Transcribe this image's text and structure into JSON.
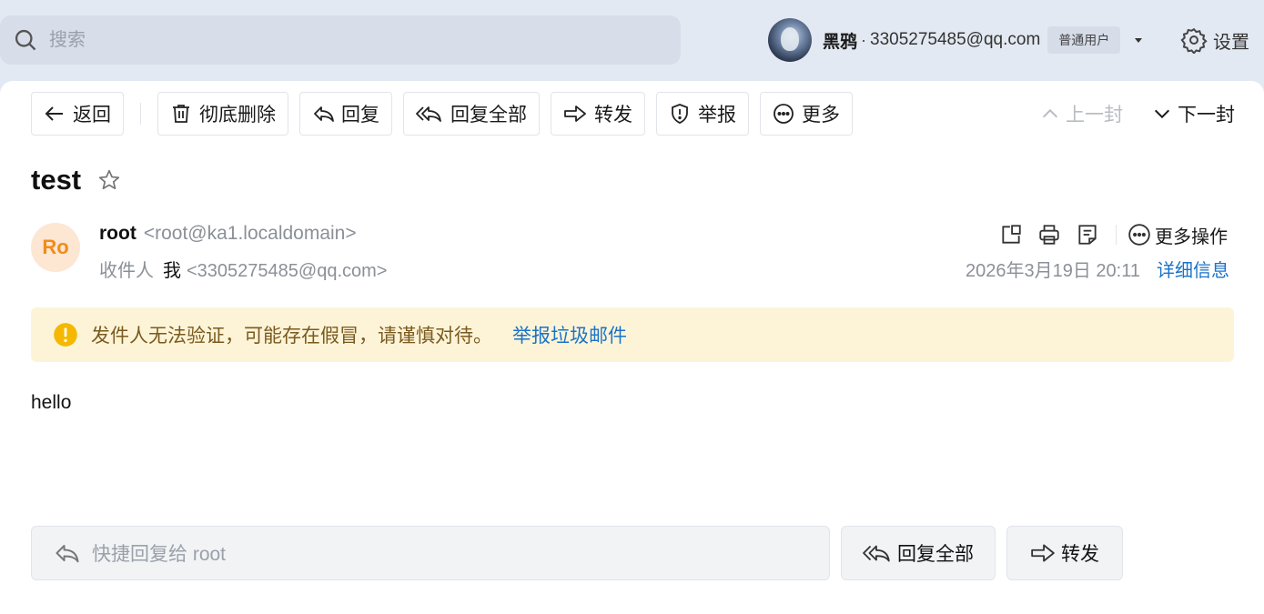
{
  "search": {
    "placeholder": "搜索"
  },
  "user": {
    "name": "黑鸦",
    "separator": "·",
    "email": "3305275485@qq.com",
    "badge": "普通用户"
  },
  "settings_label": "设置",
  "toolbar": {
    "back": "返回",
    "delete_forever": "彻底删除",
    "reply": "回复",
    "reply_all": "回复全部",
    "forward": "转发",
    "report": "举报",
    "more": "更多",
    "prev": "上一封",
    "next": "下一封"
  },
  "mail": {
    "subject": "test",
    "sender_initials": "Ro",
    "sender_name": "root",
    "sender_addr": "<root@ka1.localdomain>",
    "to_label": "收件人",
    "to_name": "我",
    "to_addr": "<3305275485@qq.com>",
    "date": "2026年3月19日 20:11",
    "detail_link": "详细信息",
    "more_ops": "更多操作",
    "body": "hello"
  },
  "warning": {
    "text": "发件人无法验证，可能存在假冒，请谨慎对待。",
    "link": "举报垃圾邮件"
  },
  "quick_reply": {
    "placeholder": "快捷回复给 root",
    "reply_all": "回复全部",
    "forward": "转发"
  },
  "colors": {
    "accent": "#1a73c8",
    "warning_bg": "#fdf4d8",
    "warning_icon": "#f5b800",
    "avatar_bg": "#fde6d2",
    "avatar_text": "#f08c1a"
  }
}
